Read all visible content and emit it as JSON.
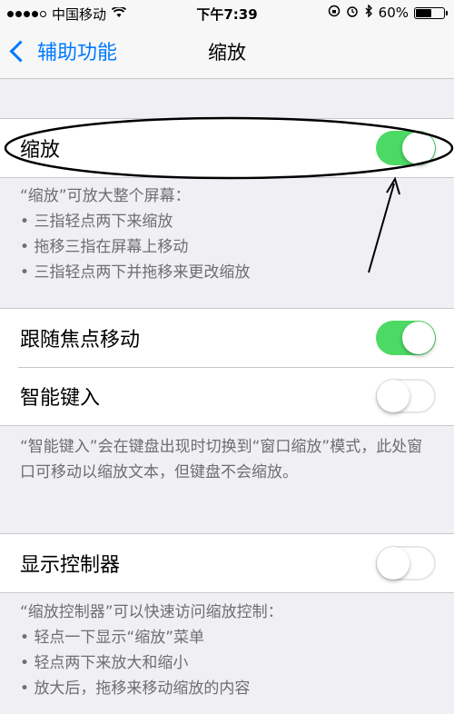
{
  "status_bar": {
    "carrier": "中国移动",
    "time": "下午7:39",
    "battery_percent": "60%",
    "battery_level": 0.6,
    "icons": [
      "signal-dots",
      "wifi-icon",
      "lock-rotation-icon",
      "alarm-icon",
      "bluetooth-icon",
      "battery-icon"
    ]
  },
  "nav": {
    "back_label": "辅助功能",
    "title": "缩放"
  },
  "zoom_section": {
    "label": "缩放",
    "toggle": "on",
    "footer_title": "“缩放”可放大整个屏幕：",
    "footer_items": [
      "三指轻点两下来缩放",
      "拖移三指在屏幕上移动",
      "三指轻点两下并拖移来更改缩放"
    ]
  },
  "follow_section": {
    "follow_focus_label": "跟随焦点移动",
    "follow_focus_toggle": "on",
    "smart_typing_label": "智能键入",
    "smart_typing_toggle": "off",
    "footer_text": "“智能键入”会在键盘出现时切换到“窗口缩放”模式，此处窗口可移动以缩放文本，但键盘不会缩放。"
  },
  "controller_section": {
    "label": "显示控制器",
    "toggle": "off",
    "footer_title": "“缩放控制器”可以快速访问缩放控制：",
    "footer_items": [
      "轻点一下显示“缩放”菜单",
      "轻点两下来放大和缩小",
      "放大后，拖移来移动缩放的内容"
    ]
  },
  "colors": {
    "toggle_on": "#4cd964",
    "link_blue": "#007aff",
    "background": "#efeff4"
  }
}
